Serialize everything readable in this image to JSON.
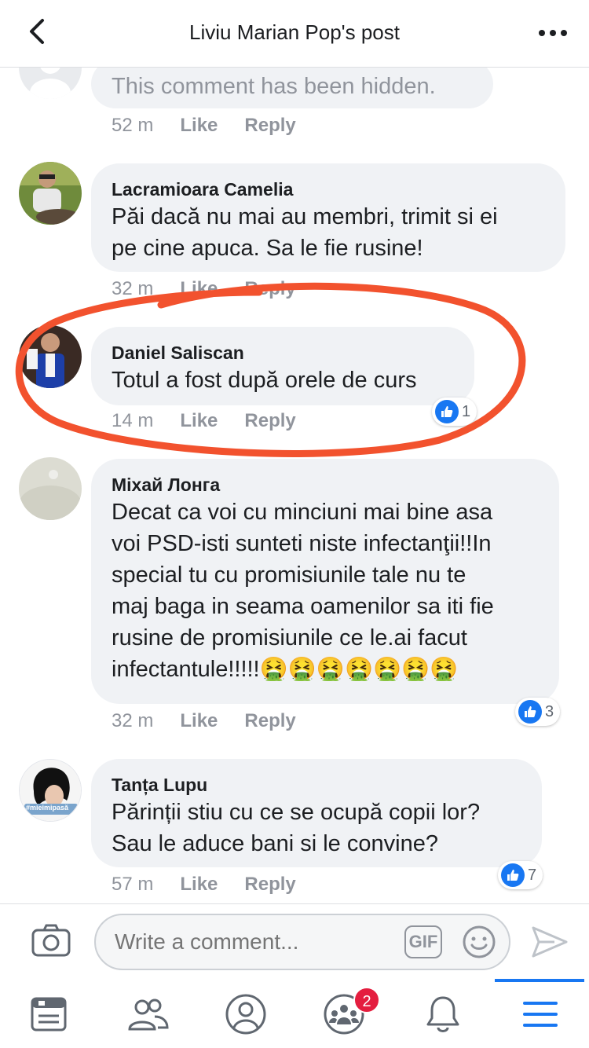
{
  "header": {
    "title": "Liviu Marian Pop's post"
  },
  "comments": [
    {
      "author": "",
      "text": "This comment has been hidden.",
      "time": "52 m",
      "like_label": "Like",
      "reply_label": "Reply"
    },
    {
      "author": "Lacramioara Camelia",
      "lines": [
        "Păi dacă nu mai au membri,  trimit si ei",
        "pe cine apuca. Sa le fie rusine!"
      ],
      "time": "32 m",
      "like_label": "Like",
      "reply_label": "Reply"
    },
    {
      "author": "Daniel Saliscan",
      "lines": [
        "Totul a fost după orele de curs"
      ],
      "time": "14 m",
      "like_label": "Like",
      "reply_label": "Reply",
      "reactions": "1"
    },
    {
      "author": "Міхай Лонга",
      "lines": [
        "Decat ca voi cu minciuni mai bine asa",
        "voi PSD-isti sunteti niste infectanţii!!In",
        "special tu cu promisiunile tale nu te",
        "maj baga in seama oamenilor sa iti fie",
        "rusine de promisiunile ce le.ai facut",
        "infectantule!!!!!🤮🤮🤮🤮🤮🤮🤮"
      ],
      "time": "32 m",
      "like_label": "Like",
      "reply_label": "Reply",
      "reactions": "3"
    },
    {
      "author": "Tanța Lupu",
      "lines": [
        "Părinții stiu cu ce se ocupă copii lor?",
        "Sau le aduce bani si le convine?"
      ],
      "time": "57 m",
      "like_label": "Like",
      "reply_label": "Reply",
      "reactions": "7",
      "avatar_tag": "#mieimipasă"
    }
  ],
  "composer": {
    "placeholder": "Write a comment...",
    "gif_label": "GIF"
  },
  "bottom_nav": {
    "items": [
      "news-feed-icon",
      "friends-icon",
      "profile-icon",
      "groups-icon",
      "bell-icon",
      "menu-icon"
    ],
    "groups_badge": "2",
    "active": "menu-icon"
  },
  "colors": {
    "accent": "#1877f2",
    "bubble": "#f0f2f5",
    "meta": "#90949c",
    "highlight": "#f2522e",
    "badge": "#e41e3f"
  }
}
